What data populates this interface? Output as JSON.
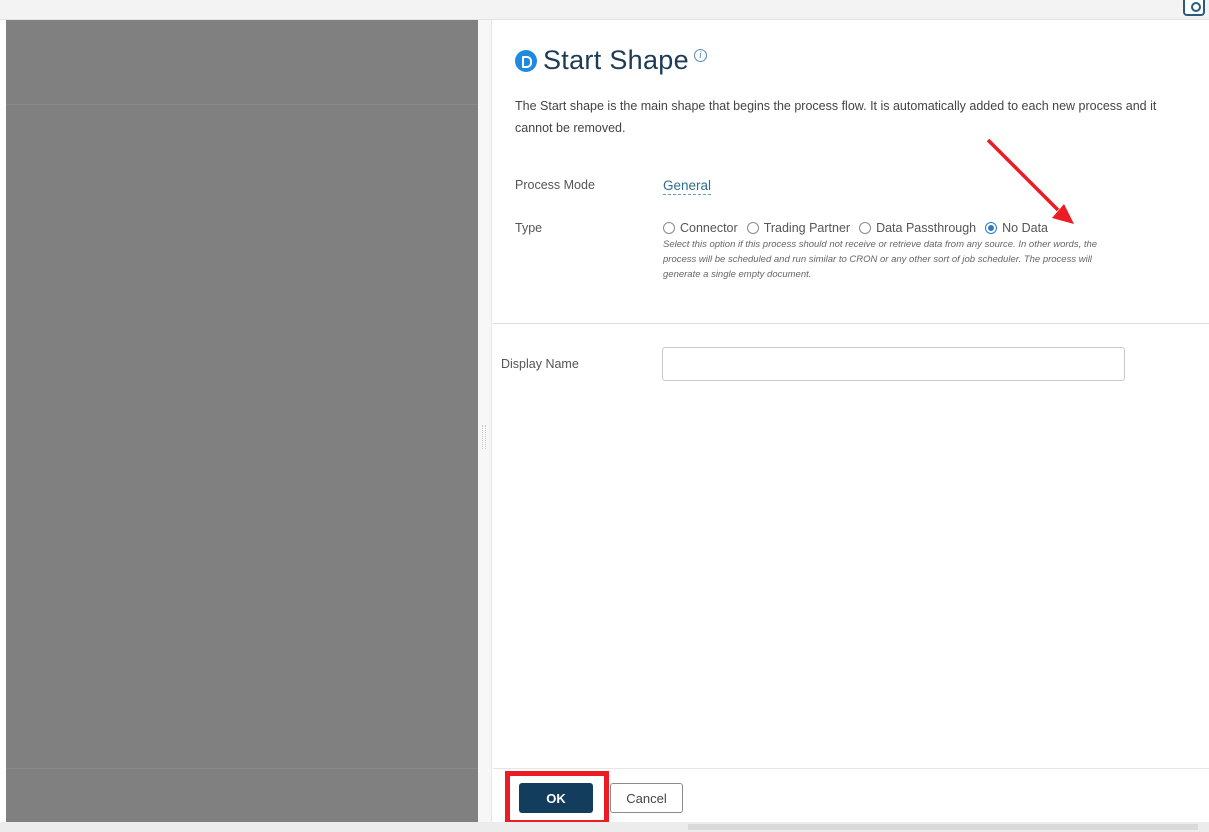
{
  "panel": {
    "title": "Start Shape",
    "description": "The Start shape is the main shape that begins the process flow. It is automatically added to each new process and it cannot be removed.",
    "process_mode_label": "Process Mode",
    "process_mode_value": "General",
    "type_label": "Type",
    "type_options": [
      {
        "label": "Connector",
        "checked": false
      },
      {
        "label": "Trading Partner",
        "checked": false
      },
      {
        "label": "Data Passthrough",
        "checked": false
      },
      {
        "label": "No Data",
        "checked": true
      }
    ],
    "type_hint": "Select this option if this process should not receive or retrieve data from any source. In other words, the process will be scheduled and run similar to CRON or any other sort of job scheduler. The process will generate a single empty document.",
    "display_name_label": "Display Name",
    "display_name_value": ""
  },
  "footer": {
    "ok_label": "OK",
    "cancel_label": "Cancel"
  },
  "colors": {
    "accent": "#123d5c",
    "annotation": "#ec1c24",
    "canvas": "#808080"
  }
}
